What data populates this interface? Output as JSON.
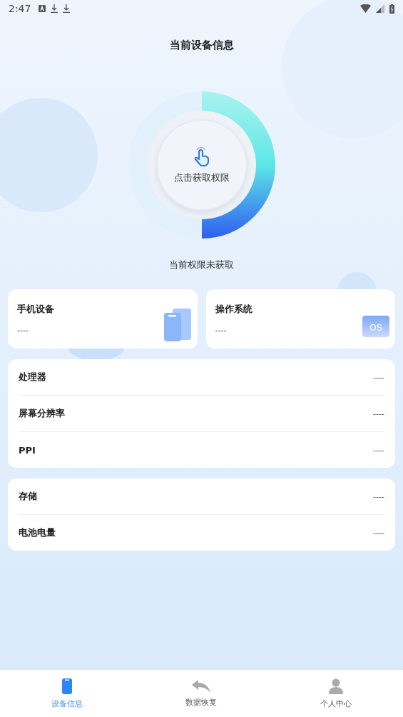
{
  "status_bar": {
    "time": "2:47"
  },
  "header": {
    "title": "当前设备信息"
  },
  "permission": {
    "button": "点击获取权限",
    "status": "当前权限未获取"
  },
  "cards": [
    {
      "kind": "phone",
      "title": "手机设备",
      "value": "----"
    },
    {
      "kind": "os",
      "title": "操作系统",
      "value": "----",
      "badge": "OS"
    }
  ],
  "groups": [
    [
      {
        "label": "处理器",
        "value": "----"
      },
      {
        "label": "屏幕分辨率",
        "value": "----"
      },
      {
        "label": "PPI",
        "value": "----"
      }
    ],
    [
      {
        "label": "存储",
        "value": "----"
      },
      {
        "label": "电池电量",
        "value": "----"
      }
    ]
  ],
  "tab_bar": [
    {
      "kind": "device",
      "label": "设备信息",
      "selected": true
    },
    {
      "kind": "restore",
      "label": "数据恢复",
      "selected": false
    },
    {
      "kind": "user",
      "label": "个人中心",
      "selected": false
    }
  ]
}
